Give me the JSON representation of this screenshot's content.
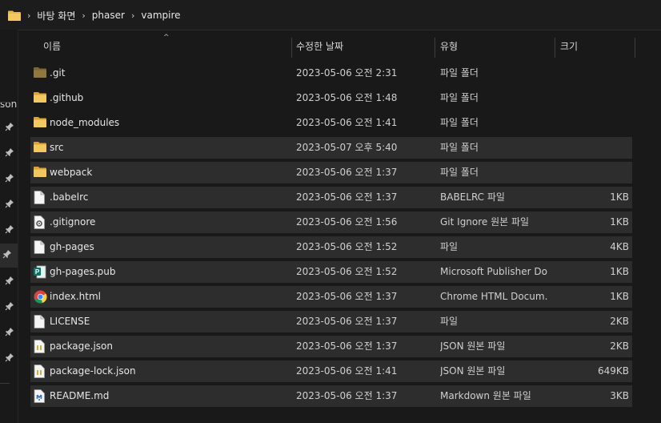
{
  "breadcrumb": {
    "root_icon": "folder-icon",
    "items": [
      "바탕 화면",
      "phaser",
      "vampire"
    ],
    "separator": "›"
  },
  "nav": {
    "partial_label": "sona",
    "pin_icon": "pin-icon"
  },
  "columns": {
    "name": "이름",
    "modified": "수정한 날짜",
    "type": "유형",
    "size": "크기",
    "sort_indicator": "^"
  },
  "colors": {
    "background": "#191919",
    "folder": "#e8b84a",
    "selected_row": "#2d2d2d"
  },
  "files": [
    {
      "name": ".git",
      "modified": "2023-05-06 오전 2:31",
      "type": "파일 폴더",
      "size": "",
      "icon": "folder-dim-icon"
    },
    {
      "name": ".github",
      "modified": "2023-05-06 오전 1:48",
      "type": "파일 폴더",
      "size": "",
      "icon": "folder-icon"
    },
    {
      "name": "node_modules",
      "modified": "2023-05-06 오전 1:41",
      "type": "파일 폴더",
      "size": "",
      "icon": "folder-icon"
    },
    {
      "name": "src",
      "modified": "2023-05-07 오후 5:40",
      "type": "파일 폴더",
      "size": "",
      "icon": "folder-icon"
    },
    {
      "name": "webpack",
      "modified": "2023-05-06 오전 1:37",
      "type": "파일 폴더",
      "size": "",
      "icon": "folder-icon"
    },
    {
      "name": ".babelrc",
      "modified": "2023-05-06 오전 1:37",
      "type": "BABELRC 파일",
      "size": "1KB",
      "icon": "file-icon"
    },
    {
      "name": ".gitignore",
      "modified": "2023-05-06 오전 1:56",
      "type": "Git Ignore 원본 파일",
      "size": "1KB",
      "icon": "settings-file-icon"
    },
    {
      "name": "gh-pages",
      "modified": "2023-05-06 오전 1:52",
      "type": "파일",
      "size": "4KB",
      "icon": "file-icon"
    },
    {
      "name": "gh-pages.pub",
      "modified": "2023-05-06 오전 1:52",
      "type": "Microsoft Publisher Do...",
      "size": "1KB",
      "icon": "publisher-icon"
    },
    {
      "name": "index.html",
      "modified": "2023-05-06 오전 1:37",
      "type": "Chrome HTML Docum...",
      "size": "1KB",
      "icon": "chrome-icon"
    },
    {
      "name": "LICENSE",
      "modified": "2023-05-06 오전 1:37",
      "type": "파일",
      "size": "2KB",
      "icon": "file-icon"
    },
    {
      "name": "package.json",
      "modified": "2023-05-06 오전 1:37",
      "type": "JSON 원본 파일",
      "size": "2KB",
      "icon": "json-file-icon"
    },
    {
      "name": "package-lock.json",
      "modified": "2023-05-06 오전 1:41",
      "type": "JSON 원본 파일",
      "size": "649KB",
      "icon": "json-file-icon"
    },
    {
      "name": "README.md",
      "modified": "2023-05-06 오전 1:37",
      "type": "Markdown 원본 파일",
      "size": "3KB",
      "icon": "markdown-file-icon"
    }
  ],
  "selected_rows": [
    "src",
    "webpack",
    ".babelrc",
    ".gitignore",
    "gh-pages",
    "gh-pages.pub",
    "index.html",
    "LICENSE",
    "package.json",
    "package-lock.json",
    "README.md"
  ]
}
